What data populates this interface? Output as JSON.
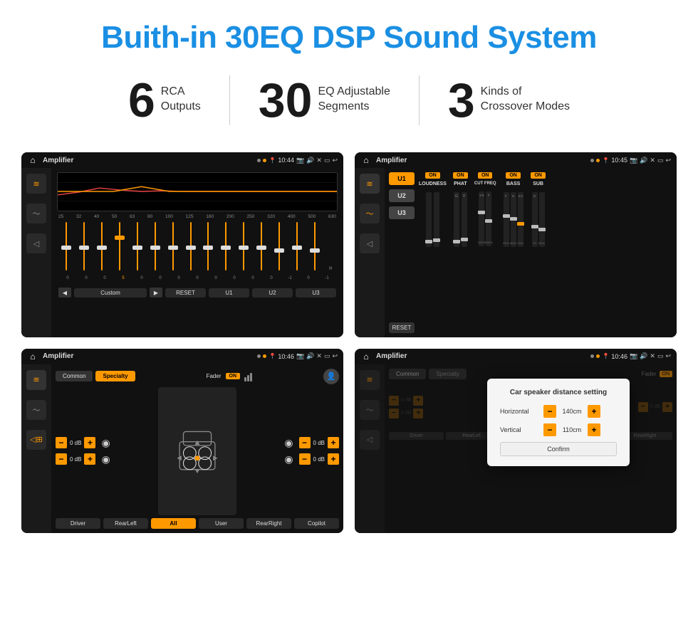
{
  "header": {
    "title": "Buith-in 30EQ DSP Sound System"
  },
  "stats": [
    {
      "number": "6",
      "label": "RCA\nOutputs"
    },
    {
      "number": "30",
      "label": "EQ Adjustable\nSegments"
    },
    {
      "number": "3",
      "label": "Kinds of\nCrossover Modes"
    }
  ],
  "screens": [
    {
      "id": "screen1",
      "status": {
        "title": "Amplifier",
        "time": "10:44"
      },
      "type": "eq",
      "freqs": [
        "25",
        "32",
        "40",
        "50",
        "63",
        "80",
        "100",
        "125",
        "160",
        "200",
        "250",
        "320",
        "400",
        "500",
        "630"
      ],
      "values": [
        "0",
        "0",
        "0",
        "5",
        "0",
        "0",
        "0",
        "0",
        "0",
        "0",
        "0",
        "0",
        "-1",
        "0",
        "-1"
      ],
      "mode": "Custom",
      "presets": [
        "RESET",
        "U1",
        "U2",
        "U3"
      ]
    },
    {
      "id": "screen2",
      "status": {
        "title": "Amplifier",
        "time": "10:45"
      },
      "type": "crossover",
      "units": [
        "U1",
        "U2",
        "U3"
      ],
      "channels": [
        "LOUDNESS",
        "PHAT",
        "CUT FREQ",
        "BASS",
        "SUB"
      ]
    },
    {
      "id": "screen3",
      "status": {
        "title": "Amplifier",
        "time": "10:46"
      },
      "type": "speaker",
      "tabs": [
        "Common",
        "Specialty"
      ],
      "fader": "Fader",
      "controls": {
        "topLeft": "0 dB",
        "topRight": "0 dB",
        "bottomLeft": "0 dB",
        "bottomRight": "0 dB"
      },
      "buttons": [
        "Driver",
        "RearLeft",
        "All",
        "User",
        "RearRight",
        "Copilot"
      ]
    },
    {
      "id": "screen4",
      "status": {
        "title": "Amplifier",
        "time": "10:46"
      },
      "type": "distance",
      "dialog": {
        "title": "Car speaker distance setting",
        "horizontal": {
          "label": "Horizontal",
          "value": "140cm"
        },
        "vertical": {
          "label": "Vertical",
          "value": "110cm"
        },
        "confirm": "Confirm"
      }
    }
  ],
  "icons": {
    "home": "⌂",
    "back": "↩",
    "play": "▶",
    "prev": "◀",
    "next": "▶",
    "eq_icon": "≋",
    "wave_icon": "〜",
    "speaker_icon": "🔊",
    "volume_icon": "◁",
    "arrow_down": "▼",
    "person": "👤",
    "fader_bars": "|||"
  },
  "colors": {
    "accent": "#f90",
    "background": "#111111",
    "sidebar": "#1a1a1a",
    "text_light": "#dddddd",
    "text_muted": "#888888",
    "title_blue": "#1a8fe3"
  }
}
